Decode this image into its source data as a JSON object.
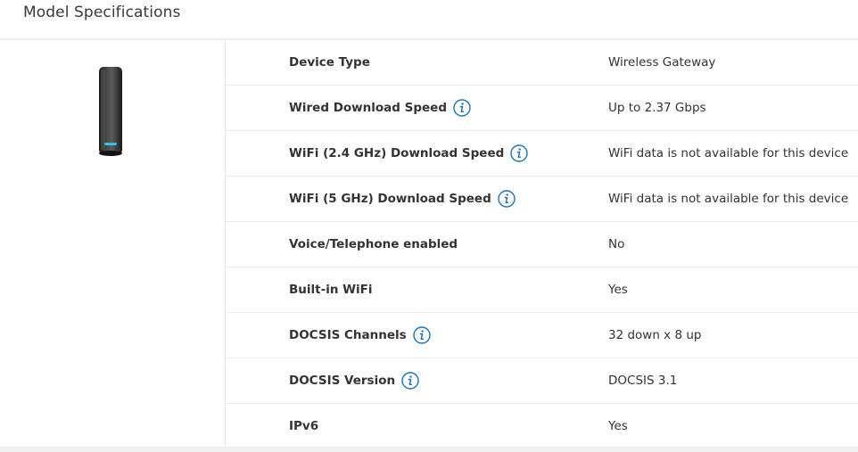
{
  "section": {
    "title": "Model Specifications"
  },
  "device_image": {
    "icon": "cable-modem-gateway-image"
  },
  "colors": {
    "info_icon": "#1a75b5",
    "led": "#2cc5e8"
  },
  "specs": [
    {
      "label": "Device Type",
      "value": "Wireless Gateway",
      "info": false
    },
    {
      "label": "Wired Download Speed",
      "value": "Up to 2.37 Gbps",
      "info": true
    },
    {
      "label": "WiFi (2.4 GHz) Download Speed",
      "value": "WiFi data is not available for this device",
      "info": true
    },
    {
      "label": "WiFi (5 GHz) Download Speed",
      "value": "WiFi data is not available for this device",
      "info": true
    },
    {
      "label": "Voice/Telephone enabled",
      "value": "No",
      "info": false
    },
    {
      "label": "Built-in WiFi",
      "value": "Yes",
      "info": false
    },
    {
      "label": "DOCSIS Channels",
      "value": "32 down x 8 up",
      "info": true
    },
    {
      "label": "DOCSIS Version",
      "value": "DOCSIS 3.1",
      "info": true
    },
    {
      "label": "IPv6",
      "value": "Yes",
      "info": false
    }
  ]
}
